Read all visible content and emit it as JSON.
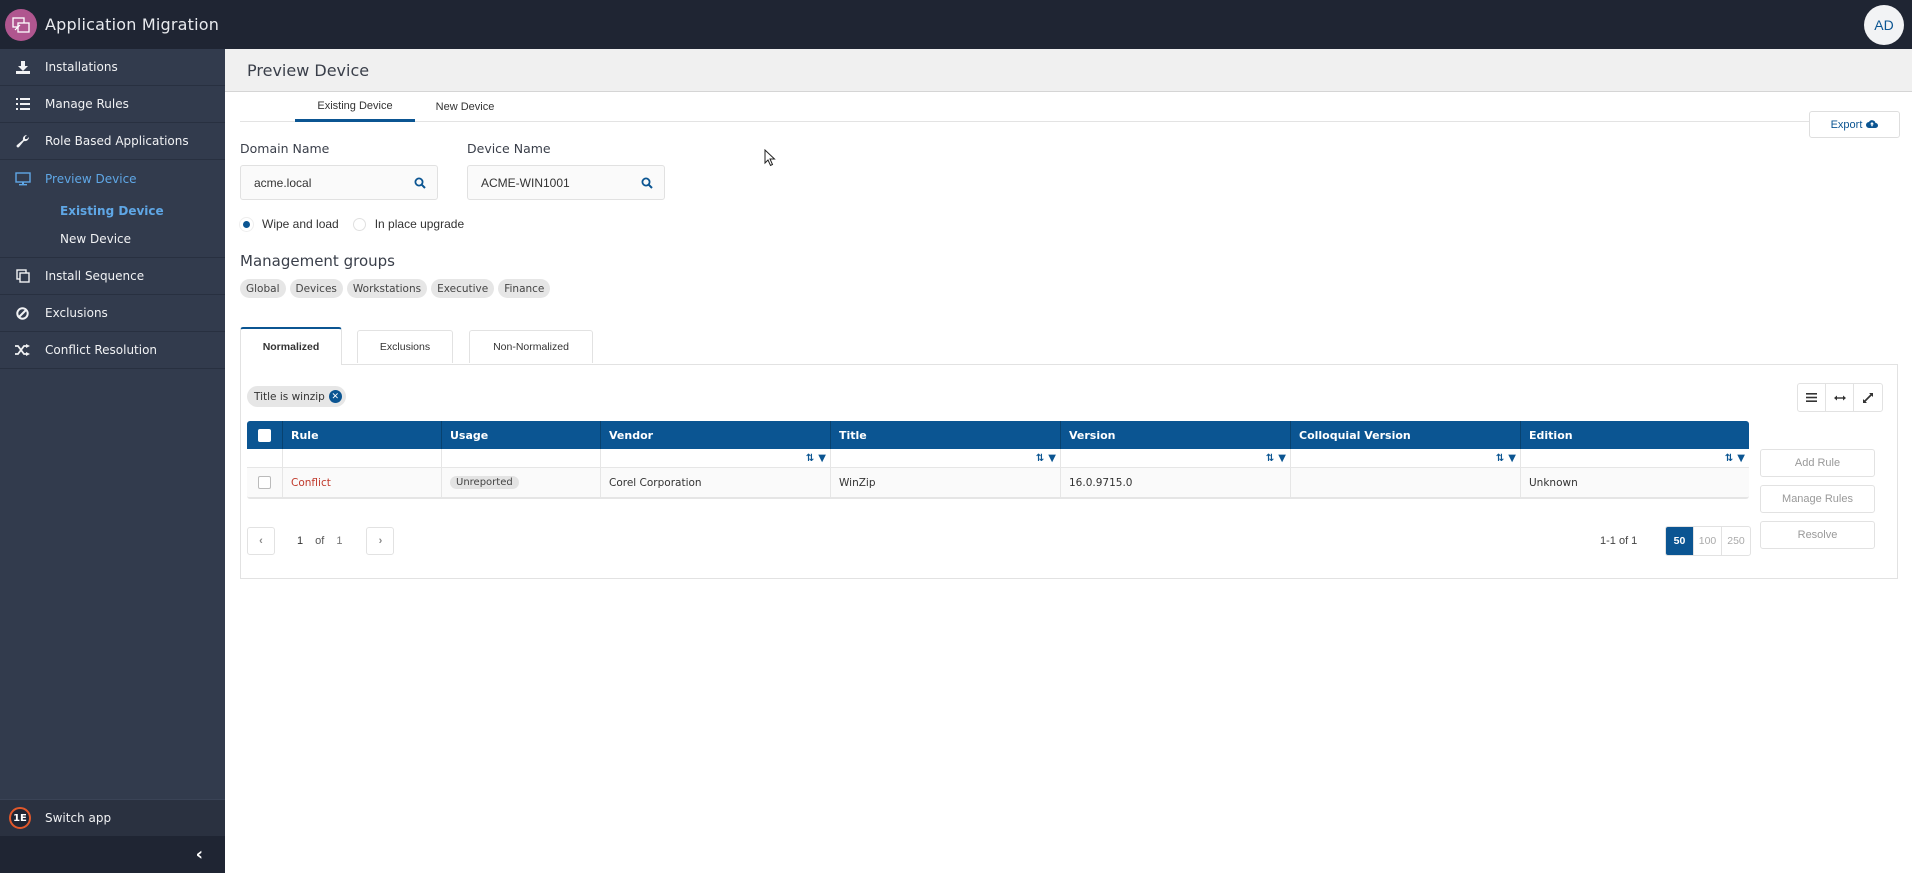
{
  "app": {
    "title": "Application Migration",
    "user_initials": "AD",
    "brand_color": "#0b5592"
  },
  "sidebar": {
    "items": [
      {
        "label": "Installations",
        "icon": "download-icon"
      },
      {
        "label": "Manage Rules",
        "icon": "list-icon"
      },
      {
        "label": "Role Based Applications",
        "icon": "wrench-icon"
      },
      {
        "label": "Preview Device",
        "icon": "monitor-icon",
        "active": true
      },
      {
        "label": "Install Sequence",
        "icon": "copy-icon"
      },
      {
        "label": "Exclusions",
        "icon": "ban-icon"
      },
      {
        "label": "Conflict Resolution",
        "icon": "shuffle-icon"
      }
    ],
    "sub_items": [
      {
        "label": "Existing Device",
        "active": true
      },
      {
        "label": "New Device"
      }
    ],
    "switch_app": "Switch app",
    "switch_app_logo": "1E"
  },
  "page": {
    "title": "Preview Device",
    "tabs": [
      {
        "label": "Existing Device",
        "active": true
      },
      {
        "label": "New Device"
      }
    ],
    "domain_label": "Domain Name",
    "domain_value": "acme.local",
    "device_label": "Device Name",
    "device_value": "ACME-WIN1001",
    "radios": [
      {
        "label": "Wipe and load",
        "checked": true
      },
      {
        "label": "In place upgrade",
        "checked": false
      }
    ],
    "export_label": "Export",
    "management_groups_title": "Management groups",
    "management_groups": [
      "Global",
      "Devices",
      "Workstations",
      "Executive",
      "Finance"
    ]
  },
  "results": {
    "tabs": [
      {
        "label": "Normalized",
        "active": true
      },
      {
        "label": "Exclusions"
      },
      {
        "label": "Non-Normalized"
      }
    ],
    "active_filter": "Title is winzip",
    "columns": [
      "Rule",
      "Usage",
      "Vendor",
      "Title",
      "Version",
      "Colloquial Version",
      "Edition"
    ],
    "rows": [
      {
        "rule": "Conflict",
        "usage": "Unreported",
        "vendor": "Corel Corporation",
        "title": "WinZip",
        "version": "16.0.9715.0",
        "colloquial_version": "",
        "edition": "Unknown"
      }
    ],
    "actions": [
      "Add Rule",
      "Manage Rules",
      "Resolve"
    ],
    "pager": {
      "current_page": "1",
      "of_label": "of",
      "total_pages": "1",
      "range_text": "1-1 of 1",
      "page_sizes": [
        "50",
        "100",
        "250"
      ],
      "selected_page_size": "50"
    }
  }
}
